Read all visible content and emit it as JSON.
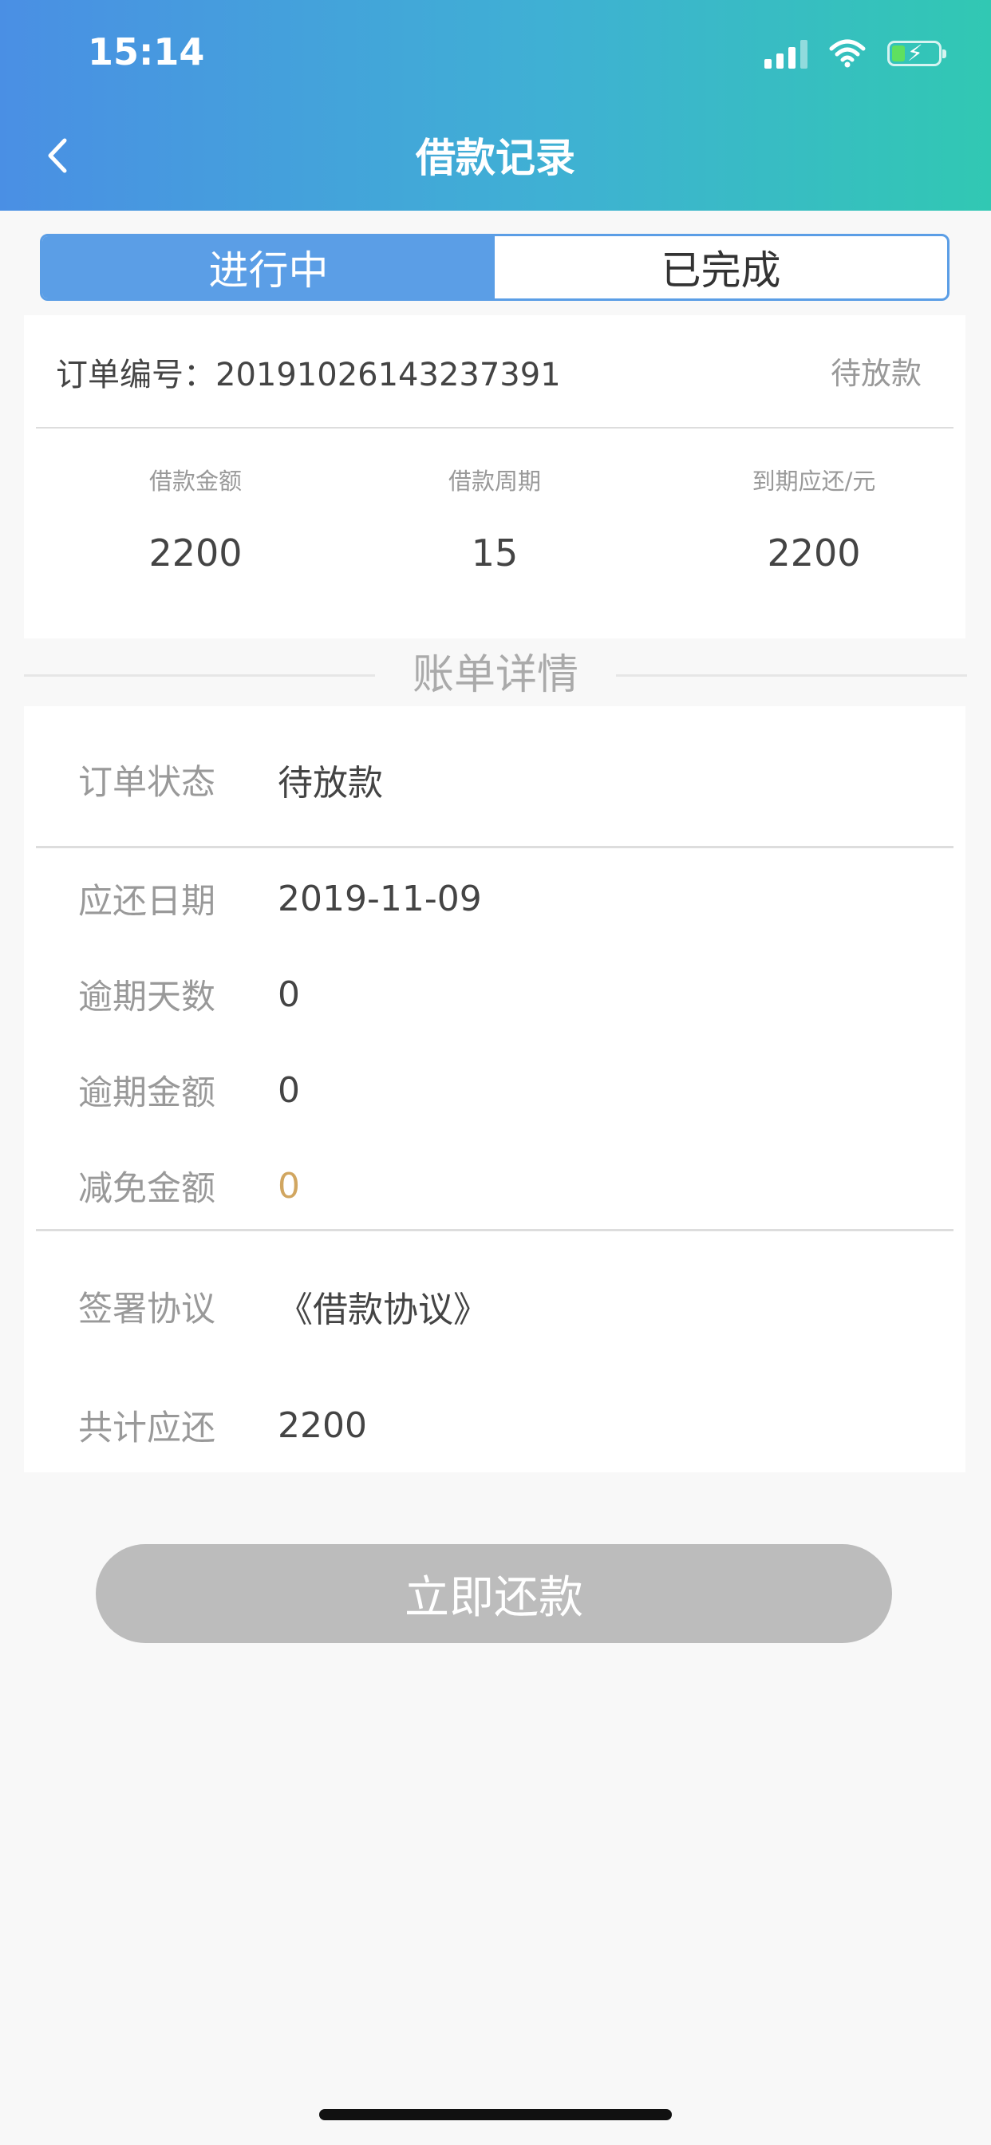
{
  "status_bar": {
    "time": "15:14"
  },
  "header": {
    "title": "借款记录",
    "back_icon": "chevron-left-icon"
  },
  "tabs": [
    {
      "label": "进行中",
      "active": true
    },
    {
      "label": "已完成",
      "active": false
    }
  ],
  "order": {
    "number_label": "订单编号：",
    "number": "20191026143237391",
    "status": "待放款",
    "stats": [
      {
        "label": "借款金额",
        "value": "2200"
      },
      {
        "label": "借款周期",
        "value": "15"
      },
      {
        "label": "到期应还/元",
        "value": "2200"
      }
    ]
  },
  "section_title": "账单详情",
  "details": {
    "order_status": {
      "label": "订单状态",
      "value": "待放款"
    },
    "due_date": {
      "label": "应还日期",
      "value": "2019-11-09"
    },
    "overdue_days": {
      "label": "逾期天数",
      "value": "0"
    },
    "overdue_amount": {
      "label": "逾期金额",
      "value": "0"
    },
    "waived_amount": {
      "label": "减免金额",
      "value": "0"
    },
    "agreement": {
      "label": "签署协议",
      "value": "《借款协议》"
    },
    "total_due": {
      "label": "共计应还",
      "value": "2200"
    }
  },
  "repay_button": {
    "label": "立即还款"
  },
  "colors": {
    "accent": "#5b9ee6",
    "gold": "#d1a660",
    "disabled_button": "#bcbcbc"
  }
}
